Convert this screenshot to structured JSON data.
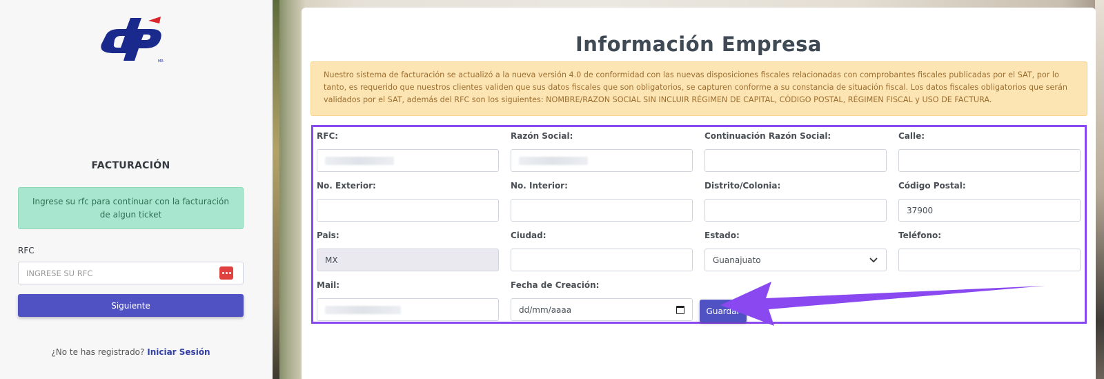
{
  "sidebar": {
    "logo_text": "dp",
    "title": "FACTURACIÓN",
    "alert": "Ingrese su rfc para continuar con la facturación de algun ticket",
    "rfc_label": "RFC",
    "rfc_placeholder": "INGRESE SU RFC",
    "next_button": "Siguiente",
    "register_text": "¿No te has registrado?",
    "register_link": "Iniciar Sesión"
  },
  "main": {
    "title": "Información Empresa",
    "notice": "Nuestro sistema de facturación se actualizó a la nueva versión 4.0 de conformidad con las nuevas disposiciones fiscales relacionadas con comprobantes fiscales publicadas por el SAT, por lo tanto, es requerido que nuestros clientes validen que sus datos fiscales que son obligatorios, se capturen conforme a su constancia de situación fiscal. Los datos fiscales obligatorios que serán validados por el SAT, además del RFC son los siguientes: NOMBRE/RAZON SOCIAL SIN INCLUIR RÉGIMEN DE CAPITAL, CÓDIGO POSTAL, RÉGIMEN FISCAL y USO DE FACTURA.",
    "fields": {
      "rfc": {
        "label": "RFC:",
        "value": ""
      },
      "razon_social": {
        "label": "Razón Social:",
        "value": ""
      },
      "continuacion": {
        "label": "Continuación Razón Social:",
        "value": ""
      },
      "calle": {
        "label": "Calle:",
        "value": ""
      },
      "no_exterior": {
        "label": "No. Exterior:",
        "value": ""
      },
      "no_interior": {
        "label": "No. Interior:",
        "value": ""
      },
      "colonia": {
        "label": "Distrito/Colonia:",
        "value": ""
      },
      "codigo_postal": {
        "label": "Código Postal:",
        "value": "37900"
      },
      "pais": {
        "label": "Pais:",
        "value": "MX"
      },
      "ciudad": {
        "label": "Ciudad:",
        "value": ""
      },
      "estado": {
        "label": "Estado:",
        "value": "Guanajuato"
      },
      "telefono": {
        "label": "Teléfono:",
        "value": ""
      },
      "mail": {
        "label": "Mail:",
        "value": ""
      },
      "fecha": {
        "label": "Fecha de Creación:",
        "value": "dd/mm/aaaa"
      }
    },
    "save_button": "Guardar"
  },
  "colors": {
    "primary_button": "#5052c4",
    "highlight_outline": "#8a48f0",
    "success_alert": "#a8e6cf",
    "warning_alert": "#fde5b3",
    "logo_blue": "#1a2a8c",
    "logo_red": "#d9262c"
  },
  "icons": [
    "password-key-icon",
    "chevron-down-icon",
    "calendar-icon",
    "arrow-annotation"
  ]
}
